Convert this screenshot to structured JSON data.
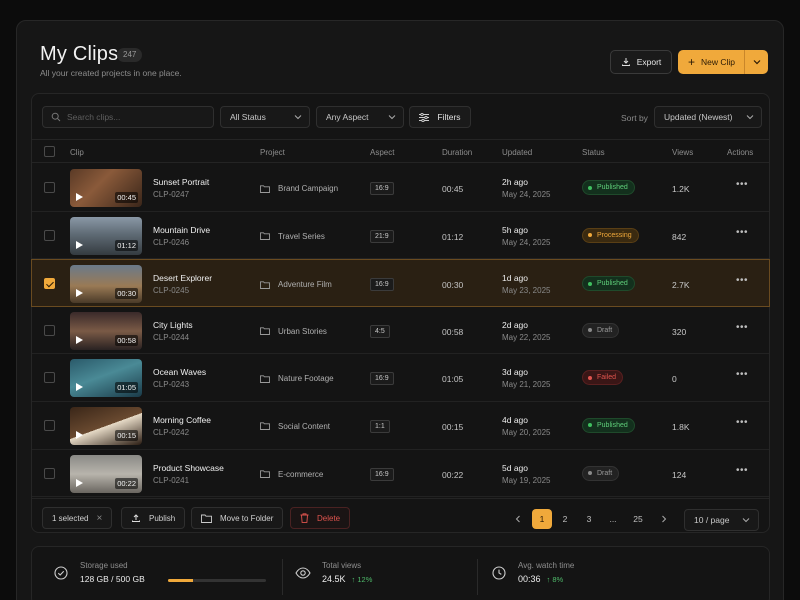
{
  "header": {
    "title": "My Clips",
    "count": "247",
    "subtitle": "All your created projects in one place.",
    "export_label": "Export",
    "new_clip_label": "New Clip"
  },
  "toolbar": {
    "search_placeholder": "Search clips...",
    "status_filter": "All Status",
    "aspect_filter": "Any Aspect",
    "filters_label": "Filters",
    "sort_by_label": "Sort by",
    "sort_value": "Updated (Newest)"
  },
  "table": {
    "columns": [
      "Clip",
      "Project",
      "Aspect",
      "Duration",
      "Updated",
      "Status",
      "Views",
      "Actions"
    ],
    "rows": [
      {
        "name": "Sunset Portrait",
        "id": "CLP-0247",
        "duration": "00:45",
        "project": "Brand Campaign",
        "aspect": "16:9",
        "updated_rel": "2h ago",
        "updated_date": "May 24, 2025",
        "status": "Published",
        "views": "1.2K",
        "selected": false
      },
      {
        "name": "Mountain Drive",
        "id": "CLP-0246",
        "duration": "01:12",
        "project": "Travel Series",
        "aspect": "21:9",
        "updated_rel": "5h ago",
        "updated_date": "May 24, 2025",
        "status": "Processing",
        "views": "842",
        "selected": false
      },
      {
        "name": "Desert Explorer",
        "id": "CLP-0245",
        "duration": "00:30",
        "project": "Adventure Film",
        "aspect": "16:9",
        "updated_rel": "1d ago",
        "updated_date": "May 23, 2025",
        "status": "Published",
        "views": "2.7K",
        "selected": true
      },
      {
        "name": "City Lights",
        "id": "CLP-0244",
        "duration": "00:58",
        "project": "Urban Stories",
        "aspect": "4:5",
        "updated_rel": "2d ago",
        "updated_date": "May 22, 2025",
        "status": "Draft",
        "views": "320",
        "selected": false
      },
      {
        "name": "Ocean Waves",
        "id": "CLP-0243",
        "duration": "01:05",
        "project": "Nature Footage",
        "aspect": "16:9",
        "updated_rel": "3d ago",
        "updated_date": "May 21, 2025",
        "status": "Failed",
        "views": "0",
        "selected": false
      },
      {
        "name": "Morning Coffee",
        "id": "CLP-0242",
        "duration": "00:15",
        "project": "Social Content",
        "aspect": "1:1",
        "updated_rel": "4d ago",
        "updated_date": "May 20, 2025",
        "status": "Published",
        "views": "1.8K",
        "selected": false
      },
      {
        "name": "Product Showcase",
        "id": "CLP-0241",
        "duration": "00:22",
        "project": "E-commerce",
        "aspect": "16:9",
        "updated_rel": "5d ago",
        "updated_date": "May 19, 2025",
        "status": "Draft",
        "views": "124",
        "selected": false
      }
    ]
  },
  "bulk": {
    "selected_label": "1 selected",
    "publish_label": "Publish",
    "move_label": "Move to Folder",
    "delete_label": "Delete"
  },
  "pagination": {
    "pages": [
      "1",
      "2",
      "3",
      "...",
      "25"
    ],
    "current": "1",
    "per_page": "10 / page"
  },
  "stats": {
    "storage_label": "Storage used",
    "storage_value": "128 GB / 500 GB",
    "storage_fraction": 0.256,
    "views_label": "Total views",
    "views_value": "24.5K",
    "views_change": "12%",
    "watch_label": "Avg. watch time",
    "watch_value": "00:36",
    "watch_change": "8%"
  },
  "colors": {
    "accent": "#f0a93b",
    "published": "#3fbf5f",
    "processing": "#f0a93b",
    "draft": "#8a8a8a",
    "failed": "#e0544e"
  }
}
